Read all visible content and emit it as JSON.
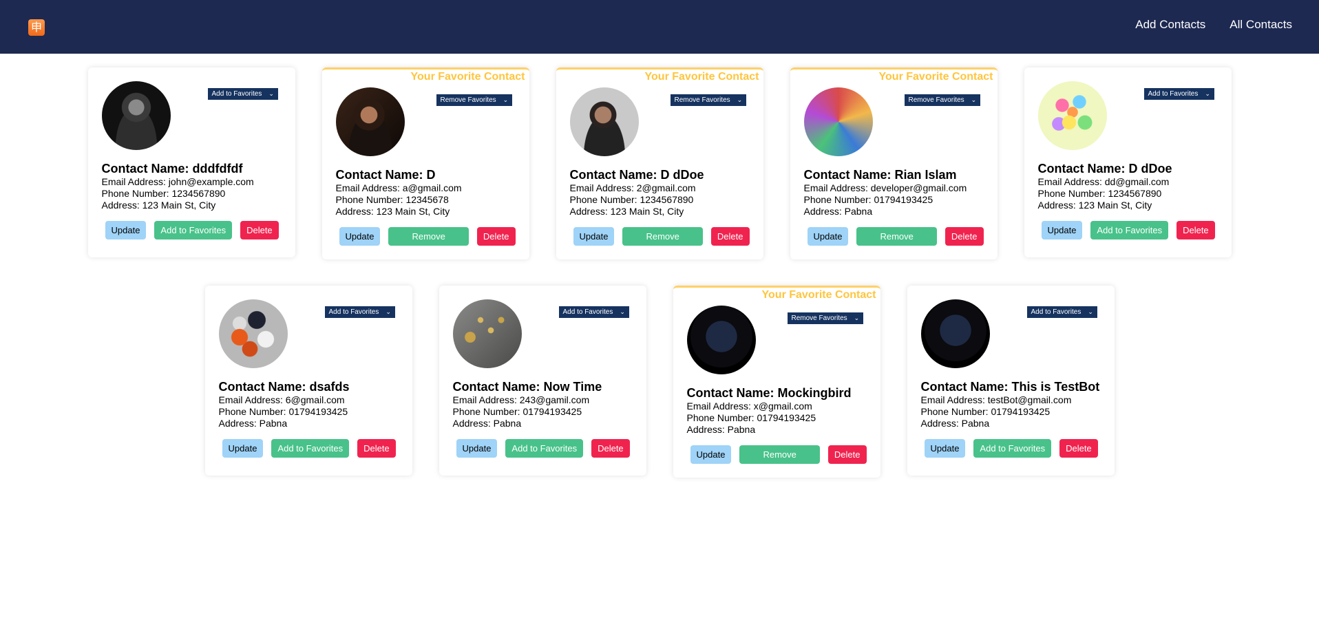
{
  "nav": {
    "logo_glyph": "申",
    "links": [
      "Add Contacts",
      "All Contacts"
    ]
  },
  "labels": {
    "favorite_banner": "Your Favorite Contact",
    "name_prefix": "Contact Name: ",
    "email_prefix": "Email Address: ",
    "phone_prefix": "Phone Number: ",
    "address_prefix": "Address: ",
    "update": "Update",
    "delete": "Delete",
    "add_fav": "Add to Favorites",
    "remove_fav": "Remove Favorites"
  },
  "colors": {
    "navbar": "#1d2951",
    "favorite_banner": "#ffc53d",
    "update_button": "#9fd3f7",
    "favorite_button": "#48c28a",
    "delete_button": "#f0234f",
    "select_bg": "#163360"
  },
  "contacts": [
    {
      "name": "dddfdfdf",
      "email": "john@example.com",
      "phone": "1234567890",
      "address": "123 Main St, City",
      "favorite": false,
      "avatar": "man-monochrome-photo"
    },
    {
      "name": "D",
      "email": "a@gmail.com",
      "phone": "12345678",
      "address": "123 Main St, City",
      "favorite": true,
      "avatar": "man-dark-photo"
    },
    {
      "name": "D dDoe",
      "email": "2@gmail.com",
      "phone": "1234567890",
      "address": "123 Main St, City",
      "favorite": true,
      "avatar": "man-gray-photo"
    },
    {
      "name": "Rian Islam",
      "email": "developer@gmail.com",
      "phone": "01794193425",
      "address": "Pabna",
      "favorite": true,
      "avatar": "graffiti-wall-photo"
    },
    {
      "name": "D dDoe",
      "email": "dd@gmail.com",
      "phone": "1234567890",
      "address": "123 Main St, City",
      "favorite": false,
      "avatar": "colorful-eggs-photo"
    },
    {
      "name": "dsafds",
      "email": "6@gmail.com",
      "phone": "01794193425",
      "address": "Pabna",
      "favorite": false,
      "avatar": "spheres-photo"
    },
    {
      "name": "Now Time",
      "email": "243@gamil.com",
      "phone": "01794193425",
      "address": "Pabna",
      "favorite": false,
      "avatar": "gold-beads-photo"
    },
    {
      "name": "Mockingbird",
      "email": "x@gmail.com",
      "phone": "01794193425",
      "address": "Pabna",
      "favorite": true,
      "avatar": "dark-orb-photo"
    },
    {
      "name": "This is TestBot",
      "email": "testBot@gmail.com",
      "phone": "01794193425",
      "address": "Pabna",
      "favorite": false,
      "avatar": "dark-orb-photo"
    }
  ]
}
